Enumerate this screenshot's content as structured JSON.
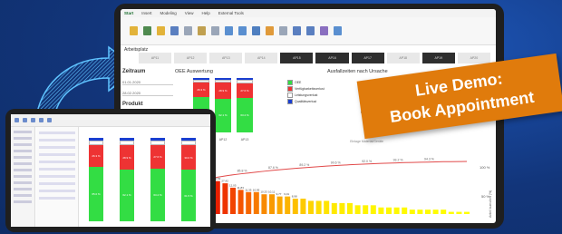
{
  "badge": {
    "line1": "Live Demo:",
    "line2": "Book Appointment"
  },
  "app": {
    "ribbon_tabs": [
      "Start",
      "Insert",
      "Modeling",
      "View",
      "Help",
      "External Tools"
    ],
    "workspace_title": "Arbeitsplatz",
    "steps": [
      {
        "label": "AP11",
        "active": false
      },
      {
        "label": "AP12",
        "active": false
      },
      {
        "label": "AP13",
        "active": false
      },
      {
        "label": "AP14",
        "active": false
      },
      {
        "label": "AP15",
        "active": true
      },
      {
        "label": "AP16",
        "active": true
      },
      {
        "label": "AP17",
        "active": true
      },
      {
        "label": "AP18",
        "active": false
      },
      {
        "label": "AP19",
        "active": true
      },
      {
        "label": "AP20",
        "active": false
      }
    ],
    "filter": {
      "period_label": "Zeitraum",
      "date_from": "01.01.2020",
      "date_to": "28.02.2020",
      "product_label": "Produkt"
    },
    "oee_title": "OEE Auswertung",
    "oee_axis": "Code",
    "reasons_title": "Ausfallzeiten nach Ursache",
    "legend": [
      {
        "label": "OEE",
        "color": "#33dd44"
      },
      {
        "label": "Verfügbarkeitsverlust",
        "color": "#ee3333"
      },
      {
        "label": "Leistungsverlust",
        "color": "#ffffff"
      },
      {
        "label": "Qualitätsverlust",
        "color": "#1a3fd0"
      }
    ],
    "reason_rows": [
      "Organisatorisch",
      "Technisch",
      "Rüstvorgang",
      "Materialmangel",
      "Personalmangel",
      "Wartung",
      "Stillstand",
      "Sonstiges",
      "Einlage Material/Geräte"
    ],
    "bars": [
      {
        "code": "AP11",
        "oee": "65.0 %",
        "avail": "26.3 %",
        "perf": "5.7 %",
        "qual": "3.0 %"
      },
      {
        "code": "AP12",
        "oee": "62.1 %",
        "avail": "28.9 %",
        "perf": "6.0 %",
        "qual": "3.0 %"
      },
      {
        "code": "AP13",
        "oee": "63.2 %",
        "avail": "27.6 %",
        "perf": "6.2 %",
        "qual": "3.0 %"
      }
    ],
    "pareto_right_top": "100 %",
    "pareto_right_mid": "50 %",
    "pareto_side_label": "Anteil kumuliert (%)"
  },
  "chart_data": {
    "type": "bar",
    "title": "OEE Auswertung",
    "xlabel": "Code",
    "categories": [
      "AP11",
      "AP12",
      "AP13"
    ],
    "series": [
      {
        "name": "OEE",
        "values": [
          65.0,
          62.1,
          63.2
        ]
      },
      {
        "name": "Verfügbarkeitsverlust",
        "values": [
          26.3,
          28.9,
          27.6
        ]
      },
      {
        "name": "Leistungsverlust",
        "values": [
          5.7,
          6.0,
          6.2
        ]
      },
      {
        "name": "Qualitätsverlust",
        "values": [
          3.0,
          3.0,
          3.0
        ]
      }
    ],
    "ylim": [
      0,
      100
    ]
  },
  "pareto_data": {
    "type": "bar",
    "values": [
      19,
      17,
      16,
      15,
      14,
      12,
      11,
      10,
      10,
      9,
      9,
      8,
      8,
      7,
      7,
      6,
      6,
      6,
      5,
      5,
      5,
      4,
      4,
      4,
      3,
      3,
      3,
      3,
      2,
      2,
      2,
      2,
      2,
      1,
      1,
      1
    ],
    "cumulative_label_values": [
      "82.1 %",
      "85.8 %",
      "87.6 %",
      "89.2 %",
      "90.6 %",
      "92.0 %",
      "93.2 %",
      "94.3 %"
    ],
    "bar_labels": [
      "48,99",
      "36,57",
      "36,31",
      "30,53",
      "27,42",
      "12,05",
      "11,83",
      "11,35",
      "10,95",
      "10,33",
      "10,11",
      "9,77",
      "9,01",
      "8,98"
    ]
  },
  "small_app": {
    "bars": [
      {
        "oee": "65.0 %",
        "avail": "26.3 %"
      },
      {
        "oee": "62.1 %",
        "avail": "28.9 %"
      },
      {
        "oee": "63.2 %",
        "avail": "27.6 %"
      },
      {
        "oee": "61.5 %",
        "avail": "30.0 %"
      }
    ]
  }
}
